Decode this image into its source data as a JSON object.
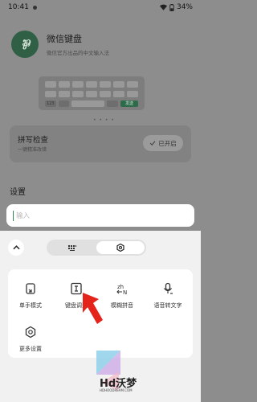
{
  "status_bar": {
    "time": "10:41",
    "battery": "34%"
  },
  "app": {
    "title": "微信键盘",
    "subtitle": "微信官方出品的中文输入法"
  },
  "preview": {
    "number_key": "123",
    "send_key": "发送",
    "page_dots": "• • • •"
  },
  "spell_check": {
    "title": "拼写检查",
    "subtitle": "一键精准改错",
    "button": "已开启"
  },
  "settings": {
    "title": "设置"
  },
  "search": {
    "placeholder": "输入"
  },
  "toolbar": {
    "tabs": [
      "keyboard-grid",
      "settings-gear"
    ],
    "active_tab": 1
  },
  "functions": [
    {
      "label": "单手模式",
      "icon": "one-hand-mode-icon"
    },
    {
      "label": "键盘调整",
      "icon": "keyboard-adjust-icon"
    },
    {
      "label": "模糊拼音",
      "icon": "fuzzy-pinyin-icon"
    },
    {
      "label": "语音转文字",
      "icon": "voice-to-text-icon"
    },
    {
      "label": "更多设置",
      "icon": "more-settings-icon"
    }
  ],
  "watermark": {
    "text": "Hd沃梦",
    "sub": "HDHOODREAM.COM"
  },
  "colors": {
    "accent": "#2d8a55",
    "arrow": "#e4241b",
    "overlay": "#8d8d8d",
    "panel": "#f1f1f1"
  }
}
